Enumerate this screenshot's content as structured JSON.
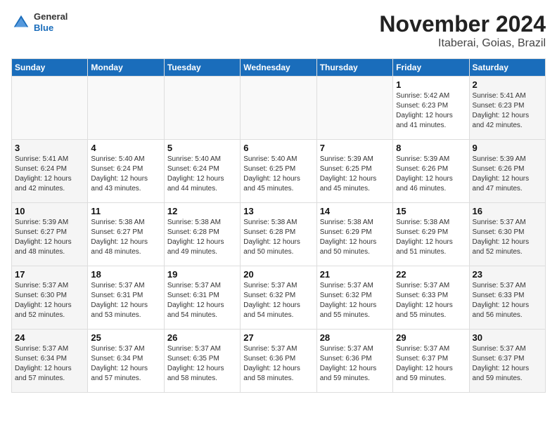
{
  "header": {
    "logo_general": "General",
    "logo_blue": "Blue",
    "month_title": "November 2024",
    "location": "Itaberai, Goias, Brazil"
  },
  "weekdays": [
    "Sunday",
    "Monday",
    "Tuesday",
    "Wednesday",
    "Thursday",
    "Friday",
    "Saturday"
  ],
  "weeks": [
    [
      {
        "day": "",
        "info": ""
      },
      {
        "day": "",
        "info": ""
      },
      {
        "day": "",
        "info": ""
      },
      {
        "day": "",
        "info": ""
      },
      {
        "day": "",
        "info": ""
      },
      {
        "day": "1",
        "info": "Sunrise: 5:42 AM\nSunset: 6:23 PM\nDaylight: 12 hours\nand 41 minutes."
      },
      {
        "day": "2",
        "info": "Sunrise: 5:41 AM\nSunset: 6:23 PM\nDaylight: 12 hours\nand 42 minutes."
      }
    ],
    [
      {
        "day": "3",
        "info": "Sunrise: 5:41 AM\nSunset: 6:24 PM\nDaylight: 12 hours\nand 42 minutes."
      },
      {
        "day": "4",
        "info": "Sunrise: 5:40 AM\nSunset: 6:24 PM\nDaylight: 12 hours\nand 43 minutes."
      },
      {
        "day": "5",
        "info": "Sunrise: 5:40 AM\nSunset: 6:24 PM\nDaylight: 12 hours\nand 44 minutes."
      },
      {
        "day": "6",
        "info": "Sunrise: 5:40 AM\nSunset: 6:25 PM\nDaylight: 12 hours\nand 45 minutes."
      },
      {
        "day": "7",
        "info": "Sunrise: 5:39 AM\nSunset: 6:25 PM\nDaylight: 12 hours\nand 45 minutes."
      },
      {
        "day": "8",
        "info": "Sunrise: 5:39 AM\nSunset: 6:26 PM\nDaylight: 12 hours\nand 46 minutes."
      },
      {
        "day": "9",
        "info": "Sunrise: 5:39 AM\nSunset: 6:26 PM\nDaylight: 12 hours\nand 47 minutes."
      }
    ],
    [
      {
        "day": "10",
        "info": "Sunrise: 5:39 AM\nSunset: 6:27 PM\nDaylight: 12 hours\nand 48 minutes."
      },
      {
        "day": "11",
        "info": "Sunrise: 5:38 AM\nSunset: 6:27 PM\nDaylight: 12 hours\nand 48 minutes."
      },
      {
        "day": "12",
        "info": "Sunrise: 5:38 AM\nSunset: 6:28 PM\nDaylight: 12 hours\nand 49 minutes."
      },
      {
        "day": "13",
        "info": "Sunrise: 5:38 AM\nSunset: 6:28 PM\nDaylight: 12 hours\nand 50 minutes."
      },
      {
        "day": "14",
        "info": "Sunrise: 5:38 AM\nSunset: 6:29 PM\nDaylight: 12 hours\nand 50 minutes."
      },
      {
        "day": "15",
        "info": "Sunrise: 5:38 AM\nSunset: 6:29 PM\nDaylight: 12 hours\nand 51 minutes."
      },
      {
        "day": "16",
        "info": "Sunrise: 5:37 AM\nSunset: 6:30 PM\nDaylight: 12 hours\nand 52 minutes."
      }
    ],
    [
      {
        "day": "17",
        "info": "Sunrise: 5:37 AM\nSunset: 6:30 PM\nDaylight: 12 hours\nand 52 minutes."
      },
      {
        "day": "18",
        "info": "Sunrise: 5:37 AM\nSunset: 6:31 PM\nDaylight: 12 hours\nand 53 minutes."
      },
      {
        "day": "19",
        "info": "Sunrise: 5:37 AM\nSunset: 6:31 PM\nDaylight: 12 hours\nand 54 minutes."
      },
      {
        "day": "20",
        "info": "Sunrise: 5:37 AM\nSunset: 6:32 PM\nDaylight: 12 hours\nand 54 minutes."
      },
      {
        "day": "21",
        "info": "Sunrise: 5:37 AM\nSunset: 6:32 PM\nDaylight: 12 hours\nand 55 minutes."
      },
      {
        "day": "22",
        "info": "Sunrise: 5:37 AM\nSunset: 6:33 PM\nDaylight: 12 hours\nand 55 minutes."
      },
      {
        "day": "23",
        "info": "Sunrise: 5:37 AM\nSunset: 6:33 PM\nDaylight: 12 hours\nand 56 minutes."
      }
    ],
    [
      {
        "day": "24",
        "info": "Sunrise: 5:37 AM\nSunset: 6:34 PM\nDaylight: 12 hours\nand 57 minutes."
      },
      {
        "day": "25",
        "info": "Sunrise: 5:37 AM\nSunset: 6:34 PM\nDaylight: 12 hours\nand 57 minutes."
      },
      {
        "day": "26",
        "info": "Sunrise: 5:37 AM\nSunset: 6:35 PM\nDaylight: 12 hours\nand 58 minutes."
      },
      {
        "day": "27",
        "info": "Sunrise: 5:37 AM\nSunset: 6:36 PM\nDaylight: 12 hours\nand 58 minutes."
      },
      {
        "day": "28",
        "info": "Sunrise: 5:37 AM\nSunset: 6:36 PM\nDaylight: 12 hours\nand 59 minutes."
      },
      {
        "day": "29",
        "info": "Sunrise: 5:37 AM\nSunset: 6:37 PM\nDaylight: 12 hours\nand 59 minutes."
      },
      {
        "day": "30",
        "info": "Sunrise: 5:37 AM\nSunset: 6:37 PM\nDaylight: 12 hours\nand 59 minutes."
      }
    ]
  ]
}
